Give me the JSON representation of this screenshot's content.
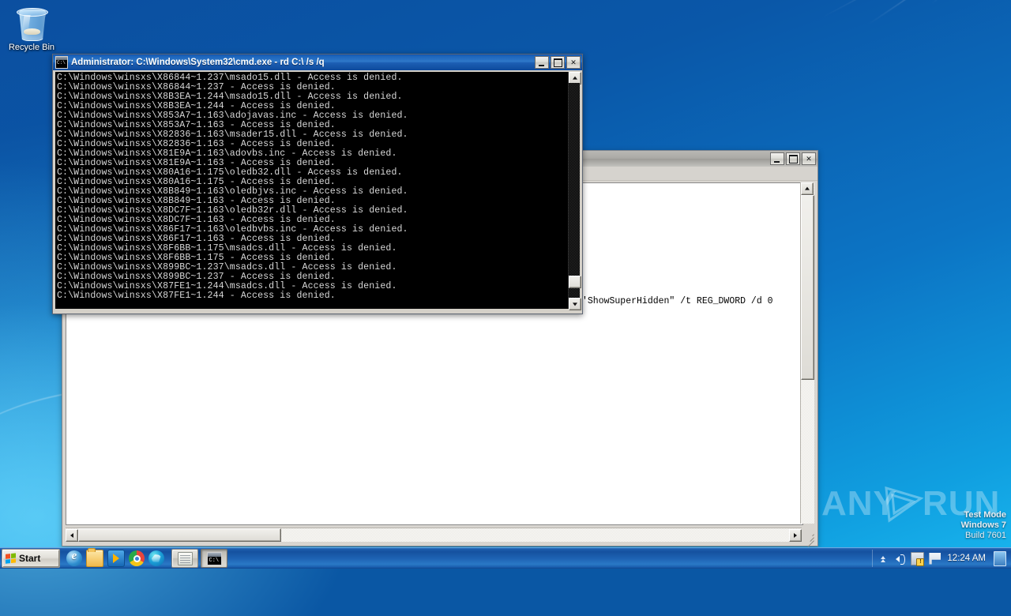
{
  "desktop": {
    "recycle_bin_label": "Recycle Bin",
    "wallpaper_accent": "#0c74c4"
  },
  "watermark": {
    "brand_any": "ANY",
    "brand_run": "RUN",
    "test_mode": "Test Mode",
    "os_name": "Windows 7",
    "build": "Build 7601"
  },
  "cmd_window": {
    "title": "Administrator: C:\\Windows\\System32\\cmd.exe - rd  C:\\ /s /q",
    "minimize_label": "_",
    "maximize_label": "□",
    "close_label": "✕",
    "console_lines": [
      "C:\\Windows\\winsxs\\X86844~1.237\\msado15.dll - Access is denied.",
      "C:\\Windows\\winsxs\\X86844~1.237 - Access is denied.",
      "C:\\Windows\\winsxs\\X8B3EA~1.244\\msado15.dll - Access is denied.",
      "C:\\Windows\\winsxs\\X8B3EA~1.244 - Access is denied.",
      "C:\\Windows\\winsxs\\X853A7~1.163\\adojavas.inc - Access is denied.",
      "C:\\Windows\\winsxs\\X853A7~1.163 - Access is denied.",
      "C:\\Windows\\winsxs\\X82836~1.163\\msader15.dll - Access is denied.",
      "C:\\Windows\\winsxs\\X82836~1.163 - Access is denied.",
      "C:\\Windows\\winsxs\\X81E9A~1.163\\adovbs.inc - Access is denied.",
      "C:\\Windows\\winsxs\\X81E9A~1.163 - Access is denied.",
      "C:\\Windows\\winsxs\\X80A16~1.175\\oledb32.dll - Access is denied.",
      "C:\\Windows\\winsxs\\X80A16~1.175 - Access is denied.",
      "C:\\Windows\\winsxs\\X8B849~1.163\\oledbjvs.inc - Access is denied.",
      "C:\\Windows\\winsxs\\X8B849~1.163 - Access is denied.",
      "C:\\Windows\\winsxs\\X8DC7F~1.163\\oledb32r.dll - Access is denied.",
      "C:\\Windows\\winsxs\\X8DC7F~1.163 - Access is denied.",
      "C:\\Windows\\winsxs\\X86F17~1.163\\oledbvbs.inc - Access is denied.",
      "C:\\Windows\\winsxs\\X86F17~1.163 - Access is denied.",
      "C:\\Windows\\winsxs\\X8F6BB~1.175\\msadcs.dll - Access is denied.",
      "C:\\Windows\\winsxs\\X8F6BB~1.175 - Access is denied.",
      "C:\\Windows\\winsxs\\X899BC~1.237\\msadcs.dll - Access is denied.",
      "C:\\Windows\\winsxs\\X899BC~1.237 - Access is denied.",
      "C:\\Windows\\winsxs\\X87FE1~1.244\\msadcs.dll - Access is denied.",
      "C:\\Windows\\winsxs\\X87FE1~1.244 - Access is denied."
    ]
  },
  "doc_window": {
    "title": "",
    "minimize_label": "_",
    "maximize_label": "□",
    "close_label": "✕",
    "text_lines": [
      "'ShowSuperHidden\" /t REG_DWORD /d 0"
    ]
  },
  "taskbar": {
    "start_label": "Start",
    "quicklaunch": [
      {
        "name": "internet-explorer-icon",
        "title": "Internet Explorer"
      },
      {
        "name": "explorer-icon",
        "title": "Windows Explorer"
      },
      {
        "name": "media-player-icon",
        "title": "Windows Media Player"
      },
      {
        "name": "chrome-icon",
        "title": "Google Chrome"
      },
      {
        "name": "edge-icon",
        "title": "Microsoft Edge"
      }
    ],
    "tasks": [
      {
        "name": "task-notepad",
        "title": "Notepad window"
      },
      {
        "name": "task-cmd",
        "title": "Administrator: cmd.exe",
        "active": true
      }
    ],
    "tray": {
      "chevron_title": "Show hidden icons",
      "volume_title": "Volume",
      "network_title": "Network - no Internet access",
      "action_center_title": "Action Center",
      "clock": "12:24 AM",
      "show_desktop_title": "Show desktop"
    }
  }
}
